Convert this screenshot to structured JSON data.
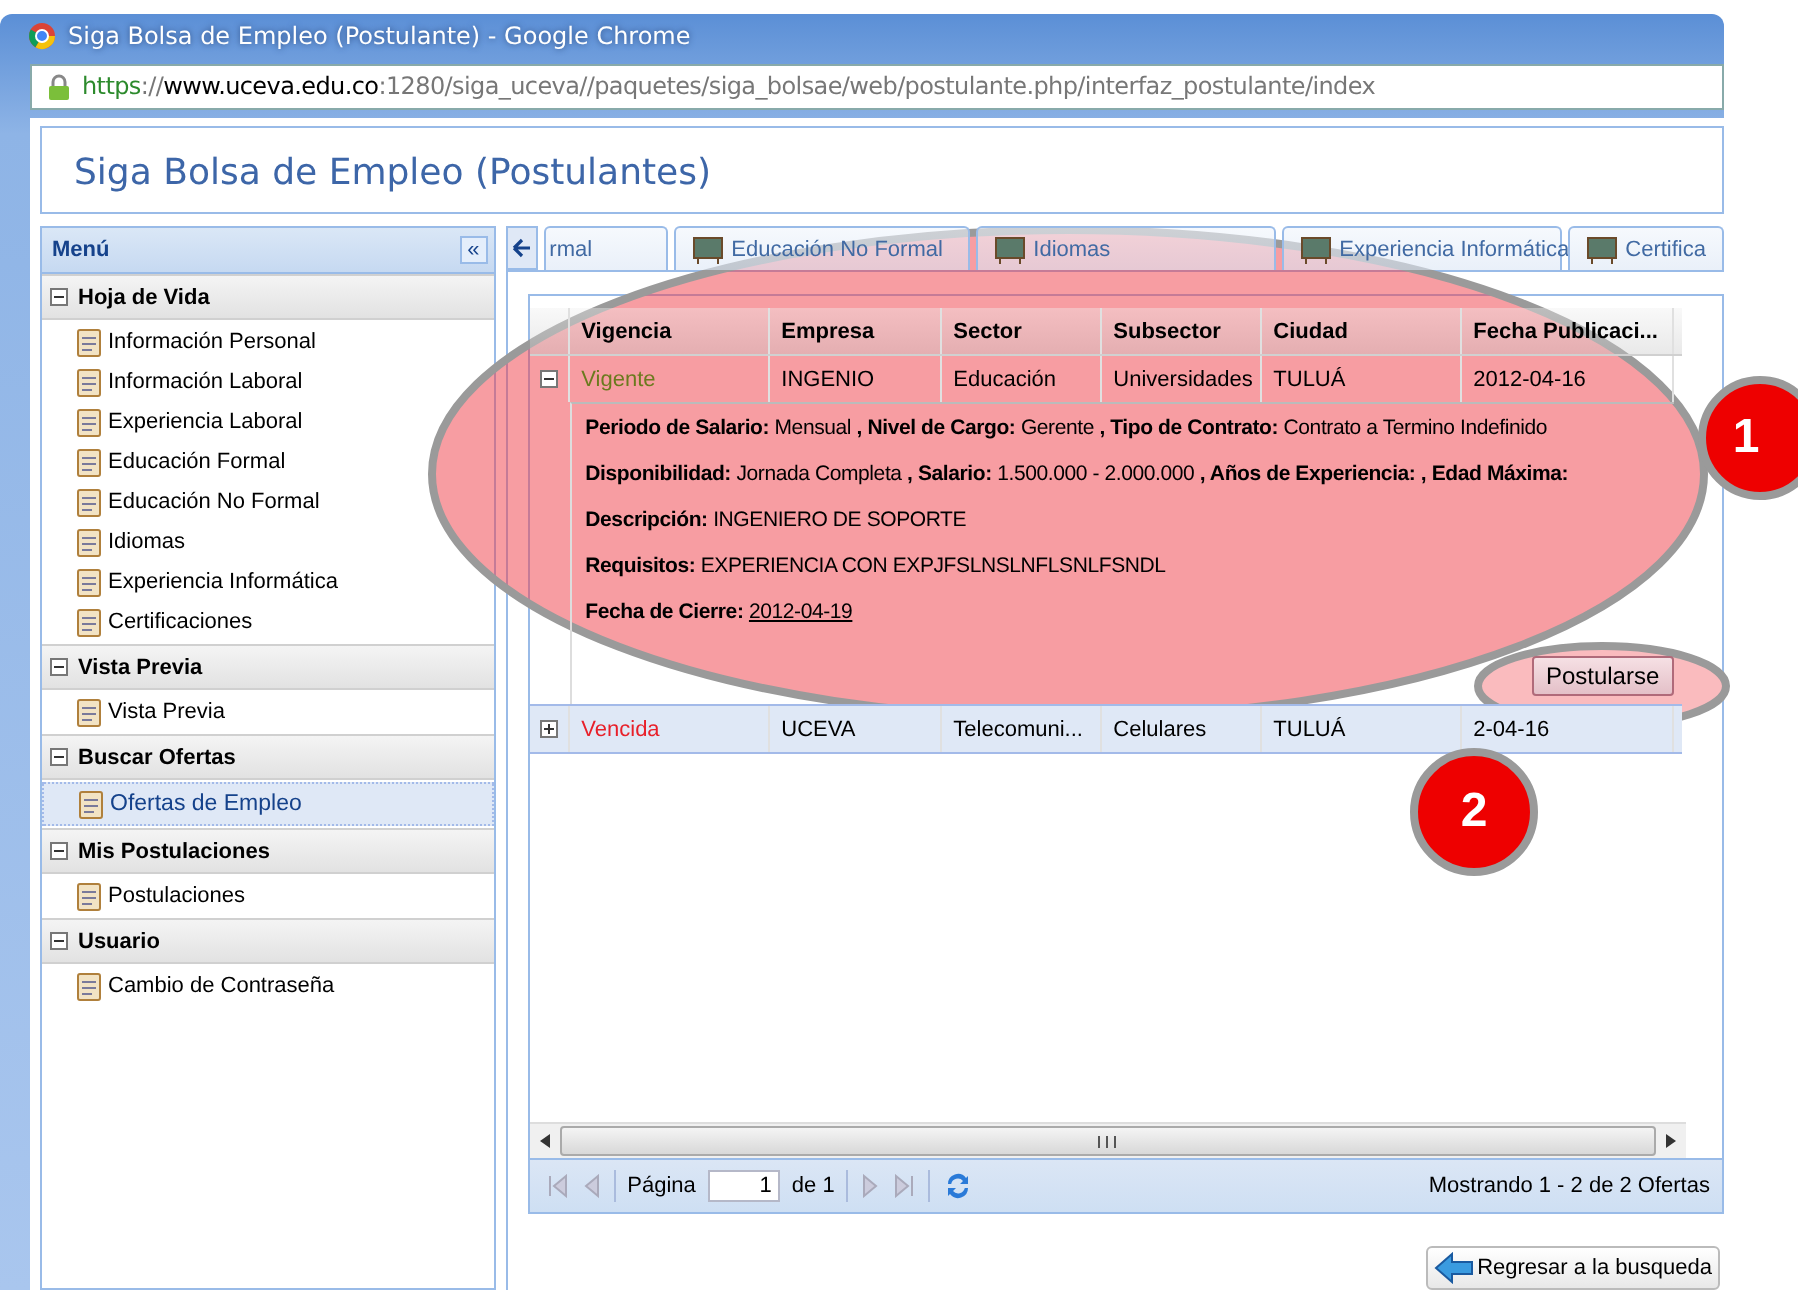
{
  "window": {
    "title": "Siga Bolsa de Empleo (Postulante) - Google Chrome",
    "url": {
      "scheme": "https",
      "separator": "://",
      "host": "www.uceva.edu.co",
      "rest": ":1280/siga_uceva//paquetes/siga_bolsae/web/postulante.php/interfaz_postulante/index"
    }
  },
  "page_title": "Siga Bolsa de Empleo (Postulantes)",
  "sidebar": {
    "title": "Menú",
    "collapse": "«",
    "groups": [
      {
        "label": "Hoja de Vida",
        "expanded": true,
        "items": [
          {
            "label": "Información Personal",
            "selected": false
          },
          {
            "label": "Información Laboral",
            "selected": false
          },
          {
            "label": "Experiencia Laboral",
            "selected": false
          },
          {
            "label": "Educación Formal",
            "selected": false
          },
          {
            "label": "Educación No Formal",
            "selected": false
          },
          {
            "label": "Idiomas",
            "selected": false
          },
          {
            "label": "Experiencia Informática",
            "selected": false
          },
          {
            "label": "Certificaciones",
            "selected": false
          }
        ]
      },
      {
        "label": "Vista Previa",
        "expanded": true,
        "items": [
          {
            "label": "Vista Previa",
            "selected": false
          }
        ]
      },
      {
        "label": "Buscar Ofertas",
        "expanded": true,
        "items": [
          {
            "label": "Ofertas de Empleo",
            "selected": true
          }
        ]
      },
      {
        "label": "Mis Postulaciones",
        "expanded": true,
        "items": [
          {
            "label": "Postulaciones",
            "selected": false
          }
        ]
      },
      {
        "label": "Usuario",
        "expanded": true,
        "items": [
          {
            "label": "Cambio de Contraseña",
            "selected": false
          }
        ]
      }
    ]
  },
  "tabs": [
    {
      "label": "rmal",
      "selected": false
    },
    {
      "label": "Educación No Formal",
      "selected": false
    },
    {
      "label": "Idiomas",
      "selected": false
    },
    {
      "label": "Experiencia Informática",
      "selected": false
    },
    {
      "label": "Certifica",
      "selected": false
    }
  ],
  "grid": {
    "columns": [
      "Vigencia",
      "Empresa",
      "Sector",
      "Subsector",
      "Ciudad",
      "Fecha Publicaci..."
    ],
    "rows": [
      {
        "expanded": true,
        "selected": false,
        "color": "#6b7a1e",
        "cells": [
          "Vigente",
          "INGENIO",
          "Educación",
          "Universidades",
          "TULUÁ",
          "2012-04-16"
        ],
        "detail": {
          "lines": [
            "**Periodo de Salario:** Mensual **, Nivel de Cargo:** Gerente **, Tipo de Contrato:** Contrato a Termino Indefinido",
            "**Disponibilidad:** Jornada Completa **, Salario:** 1.500.000 - 2.000.000 **, Años de Experiencia: , Edad Máxima:**",
            "**Descripción:** INGENIERO DE SOPORTE",
            "**Requisitos:** EXPERIENCIA CON EXPJFSLNSLNFLSNLFSNDL"
          ],
          "closing_label": "Fecha de Cierre:",
          "closing_date": "2012-04-19",
          "button": "Postularse"
        }
      },
      {
        "expanded": false,
        "selected": true,
        "color": "#e8202a",
        "cells": [
          "Vencida",
          "UCEVA",
          "Telecomuni...",
          "Celulares",
          "TULUÁ",
          "2-04-16"
        ]
      }
    ]
  },
  "pager": {
    "page_label": "Página",
    "page_value": "1",
    "of_label": "de 1",
    "summary": "Mostrando 1 - 2 de 2 Ofertas"
  },
  "back_button": "Regresar a la busqueda",
  "annotations": [
    {
      "number": "1"
    },
    {
      "number": "2"
    }
  ]
}
